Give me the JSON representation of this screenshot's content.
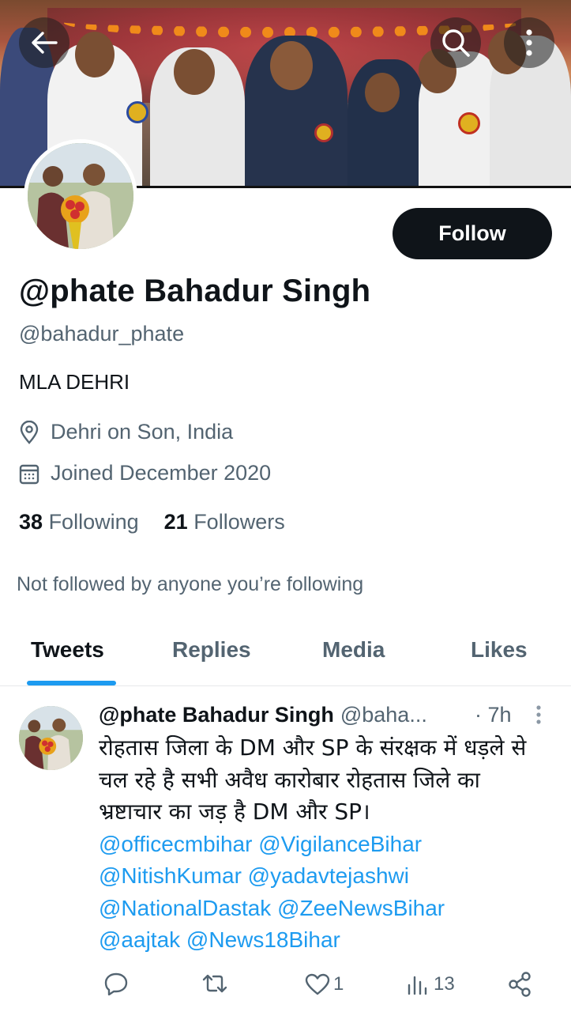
{
  "colors": {
    "accent": "#1d9bf0",
    "text": "#0f1419",
    "muted": "#536471",
    "follow_bg": "#0f1419"
  },
  "header": {
    "back_icon": "back-arrow-icon",
    "search_icon": "search-icon",
    "more_icon": "more-vertical-icon"
  },
  "profile": {
    "display_name": "@phate Bahadur Singh",
    "handle": "@bahadur_phate",
    "bio": "MLA DEHRI",
    "location": "Dehri on Son, India",
    "joined": "Joined December 2020",
    "following_count": "38",
    "following_label": "Following",
    "followers_count": "21",
    "followers_label": "Followers",
    "not_followed_text": "Not followed by anyone you’re following",
    "follow_label": "Follow"
  },
  "tabs": [
    {
      "label": "Tweets",
      "active": true
    },
    {
      "label": "Replies",
      "active": false
    },
    {
      "label": "Media",
      "active": false
    },
    {
      "label": "Likes",
      "active": false
    }
  ],
  "tweet": {
    "author_name": "@phate Bahadur Singh",
    "author_handle": "@baha...",
    "time": "· 7h",
    "text_line1": "रोहतास जिला के DM और SP के संरक्षक में धड़ले से",
    "text_line2": "चल रहे है सभी अवैध कारोबार रोहतास जिले का",
    "text_line3": "भ्रष्टाचार का जड़ है DM और SP।",
    "mentions_line1": "@officecmbihar @VigilanceBihar",
    "mentions_line2": "@NitishKumar @yadavtejashwi",
    "mentions_line3": "@NationalDastak @ZeeNewsBihar",
    "mentions_line4": "@aajtak @News18Bihar",
    "likes": "1",
    "views": "13"
  }
}
